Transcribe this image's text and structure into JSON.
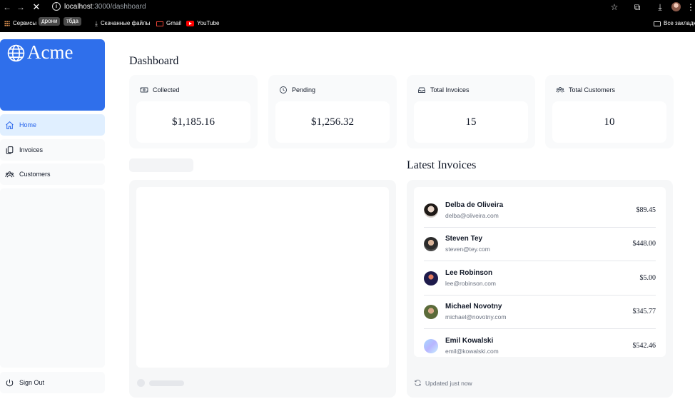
{
  "browser": {
    "url_host": "localhost",
    "url_path": ":3000/dashboard",
    "bookmarks": [
      {
        "label": "Сервисы",
        "icon": "apps-grid-icon"
      },
      {
        "label": "дрони",
        "icon": "folder-chip"
      },
      {
        "label": "тбда",
        "icon": "folder-chip"
      },
      {
        "label": "Скачанные файлы",
        "icon": "download-icon"
      },
      {
        "label": "Gmail",
        "icon": "gmail-icon"
      },
      {
        "label": "YouTube",
        "icon": "youtube-icon"
      }
    ],
    "all_bookmarks": "Все закладки"
  },
  "sidebar": {
    "logo": "Acme",
    "items": [
      {
        "label": "Home",
        "icon": "home-icon",
        "active": true
      },
      {
        "label": "Invoices",
        "icon": "document-duplicate-icon",
        "active": false
      },
      {
        "label": "Customers",
        "icon": "user-group-icon",
        "active": false
      }
    ],
    "signout": "Sign Out"
  },
  "main": {
    "title": "Dashboard",
    "cards": [
      {
        "title": "Collected",
        "value": "$1,185.16",
        "icon": "banknotes-icon"
      },
      {
        "title": "Pending",
        "value": "$1,256.32",
        "icon": "clock-icon"
      },
      {
        "title": "Total Invoices",
        "value": "15",
        "icon": "inbox-icon"
      },
      {
        "title": "Total Customers",
        "value": "10",
        "icon": "user-group-icon"
      }
    ],
    "latest": {
      "title": "Latest Invoices",
      "rows": [
        {
          "name": "Delba de Oliveira",
          "email": "delba@oliveira.com",
          "amount": "$89.45"
        },
        {
          "name": "Steven Tey",
          "email": "steven@tey.com",
          "amount": "$448.00"
        },
        {
          "name": "Lee Robinson",
          "email": "lee@robinson.com",
          "amount": "$5.00"
        },
        {
          "name": "Michael Novotny",
          "email": "michael@novotny.com",
          "amount": "$345.77"
        },
        {
          "name": "Emil Kowalski",
          "email": "emil@kowalski.com",
          "amount": "$542.46"
        }
      ],
      "updated": "Updated just now"
    }
  },
  "colors": {
    "brand": "#2f6feb",
    "active_nav_bg": "#e0efff",
    "active_nav_text": "#2563eb"
  }
}
